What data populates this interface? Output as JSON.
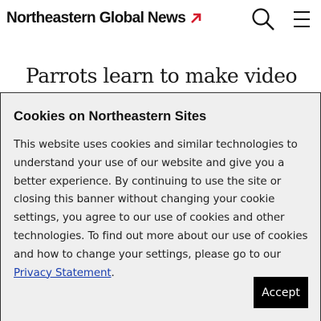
{
  "header": {
    "logo_text": "Northeastern Global News",
    "logo_icon": "arrow-up-right-icon",
    "search_icon": "search-icon",
    "menu_icon": "hamburger-menu-icon",
    "accent_color": "#d41b2c"
  },
  "article": {
    "headline": "Parrots learn to make video"
  },
  "cookie_banner": {
    "title": "Cookies on Northeastern Sites",
    "body": "This website uses cookies and similar technologies to understand your use of our website and give you a better experience. By continuing to use the site or closing this banner without changing your cookie settings, you agree to our use of cookies and other technologies. To find out more about our use of cookies and how to change your settings, please go to our ",
    "link_text": "Privacy Statement",
    "body_end": ".",
    "accept_label": "Accept"
  }
}
